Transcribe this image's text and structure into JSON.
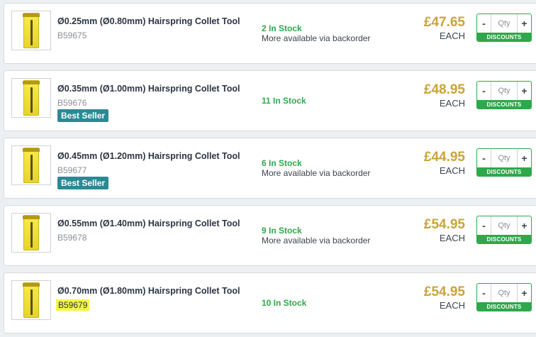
{
  "labels": {
    "each": "EACH",
    "qty_placeholder": "Qty",
    "minus": "-",
    "plus": "+",
    "discounts": "DISCOUNTS",
    "best_seller": "Best Seller",
    "backorder": "More available via backorder"
  },
  "colors": {
    "price": "#c9a43a",
    "stock": "#2ea84a",
    "badge": "#2a8a94",
    "highlight": "#f3f545"
  },
  "products": [
    {
      "title": "Ø0.25mm (Ø0.80mm) Hairspring Collet Tool",
      "sku": "B59675",
      "stock": "2 In Stock",
      "price": "£47.65"
    },
    {
      "title": "Ø0.35mm (Ø1.00mm) Hairspring Collet Tool",
      "sku": "B59676",
      "stock": "11 In Stock",
      "price": "£48.95"
    },
    {
      "title": "Ø0.45mm (Ø1.20mm) Hairspring Collet Tool",
      "sku": "B59677",
      "stock": "6 In Stock",
      "price": "£44.95"
    },
    {
      "title": "Ø0.55mm (Ø1.40mm) Hairspring Collet Tool",
      "sku": "B59678",
      "stock": "9 In Stock",
      "price": "£54.95"
    },
    {
      "title": "Ø0.70mm (Ø1.80mm) Hairspring Collet Tool",
      "sku": "B59679",
      "stock": "10 In Stock",
      "price": "£54.95"
    }
  ]
}
